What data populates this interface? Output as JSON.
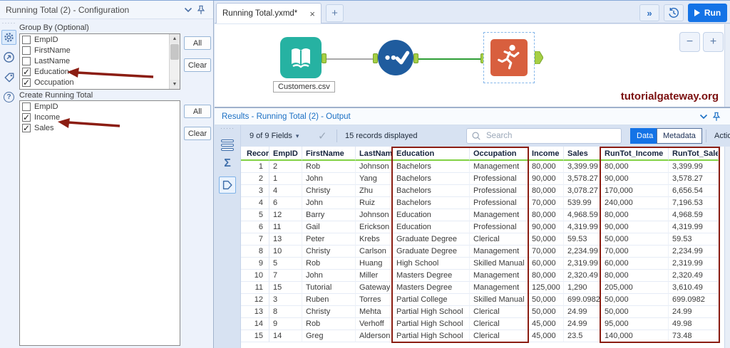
{
  "config_panel": {
    "title": "Running Total (2) - Configuration",
    "group_by": {
      "label": "Group By (Optional)",
      "items": [
        {
          "label": "EmpID",
          "checked": false
        },
        {
          "label": "FirstName",
          "checked": false
        },
        {
          "label": "LastName",
          "checked": false
        },
        {
          "label": "Education",
          "checked": true
        },
        {
          "label": "Occupation",
          "checked": true
        }
      ],
      "all_button": "All",
      "clear_button": "Clear"
    },
    "create_running_total": {
      "label": "Create Running Total",
      "items": [
        {
          "label": "EmpID",
          "checked": false
        },
        {
          "label": "Income",
          "checked": true
        },
        {
          "label": "Sales",
          "checked": true
        }
      ],
      "all_button": "All",
      "clear_button": "Clear"
    }
  },
  "tab_bar": {
    "active_tab": "Running Total.yxmd*",
    "run_button": "Run"
  },
  "canvas": {
    "input_tool_label": "Customers.csv",
    "watermark": "tutorialgateway.org"
  },
  "results": {
    "title": "Results - Running Total (2) - Output",
    "fields_summary": "9 of 9 Fields",
    "records_summary": "15 records displayed",
    "search_placeholder": "Search",
    "data_button": "Data",
    "metadata_button": "Metadata",
    "actions_button": "Actions",
    "table": {
      "columns": [
        "Record",
        "EmpID",
        "FirstName",
        "LastName",
        "Education",
        "Occupation",
        "Income",
        "Sales",
        "RunTot_Income",
        "RunTot_Sales"
      ],
      "rows": [
        [
          "1",
          "2",
          "Rob",
          "Johnson",
          "Bachelors",
          "Management",
          "80,000",
          "3,399.99",
          "80,000",
          "3,399.99"
        ],
        [
          "2",
          "1",
          "John",
          "Yang",
          "Bachelors",
          "Professional",
          "90,000",
          "3,578.27",
          "90,000",
          "3,578.27"
        ],
        [
          "3",
          "4",
          "Christy",
          "Zhu",
          "Bachelors",
          "Professional",
          "80,000",
          "3,078.27",
          "170,000",
          "6,656.54"
        ],
        [
          "4",
          "6",
          "John",
          "Ruiz",
          "Bachelors",
          "Professional",
          "70,000",
          "539.99",
          "240,000",
          "7,196.53"
        ],
        [
          "5",
          "12",
          "Barry",
          "Johnson",
          "Education",
          "Management",
          "80,000",
          "4,968.59",
          "80,000",
          "4,968.59"
        ],
        [
          "6",
          "11",
          "Gail",
          "Erickson",
          "Education",
          "Professional",
          "90,000",
          "4,319.99",
          "90,000",
          "4,319.99"
        ],
        [
          "7",
          "13",
          "Peter",
          "Krebs",
          "Graduate Degree",
          "Clerical",
          "50,000",
          "59.53",
          "50,000",
          "59.53"
        ],
        [
          "8",
          "10",
          "Christy",
          "Carlson",
          "Graduate Degree",
          "Management",
          "70,000",
          "2,234.99",
          "70,000",
          "2,234.99"
        ],
        [
          "9",
          "5",
          "Rob",
          "Huang",
          "High School",
          "Skilled Manual",
          "60,000",
          "2,319.99",
          "60,000",
          "2,319.99"
        ],
        [
          "10",
          "7",
          "John",
          "Miller",
          "Masters Degree",
          "Management",
          "80,000",
          "2,320.49",
          "80,000",
          "2,320.49"
        ],
        [
          "11",
          "15",
          "Tutorial",
          "Gateway",
          "Masters Degree",
          "Management",
          "125,000",
          "1,290",
          "205,000",
          "3,610.49"
        ],
        [
          "12",
          "3",
          "Ruben",
          "Torres",
          "Partial College",
          "Skilled Manual",
          "50,000",
          "699.0982",
          "50,000",
          "699.0982"
        ],
        [
          "13",
          "8",
          "Christy",
          "Mehta",
          "Partial High School",
          "Clerical",
          "50,000",
          "24.99",
          "50,000",
          "24.99"
        ],
        [
          "14",
          "9",
          "Rob",
          "Verhoff",
          "Partial High School",
          "Clerical",
          "45,000",
          "24.99",
          "95,000",
          "49.98"
        ],
        [
          "15",
          "14",
          "Greg",
          "Alderson",
          "Partial High School",
          "Clerical",
          "45,000",
          "23.5",
          "140,000",
          "73.48"
        ]
      ]
    }
  },
  "colors": {
    "accent_blue": "#1473e6",
    "results_title_blue": "#1a6fc4",
    "header_underline_green": "#82d245",
    "annotation_red": "#8b1d12",
    "input_tool_teal": "#26b2a2",
    "middle_tool_blue": "#1f5c9e",
    "running_tool_orange": "#d85f3e",
    "connector_green": "#2e9e36"
  },
  "icons": {
    "caret_down": "▾",
    "check": "✓",
    "close": "×",
    "new_tab": "+",
    "more": "»",
    "sigma": "Σ",
    "question": "?",
    "zoom_in": "+",
    "zoom_out": "−",
    "grip_dots": "·····"
  }
}
